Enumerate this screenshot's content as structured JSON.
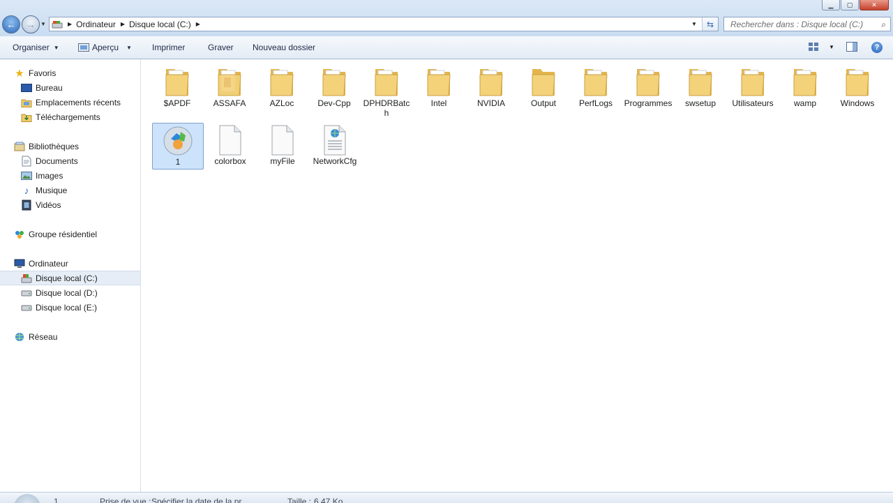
{
  "address": {
    "crumbs": [
      "Ordinateur",
      "Disque local (C:)"
    ]
  },
  "search": {
    "placeholder": "Rechercher dans : Disque local (C:)"
  },
  "toolbar": {
    "organize": "Organiser",
    "preview": "Aperçu",
    "print": "Imprimer",
    "burn": "Graver",
    "new_folder": "Nouveau dossier"
  },
  "sidebar": {
    "favorites": {
      "label": "Favoris",
      "items": [
        "Bureau",
        "Emplacements récents",
        "Téléchargements"
      ]
    },
    "libraries": {
      "label": "Bibliothèques",
      "items": [
        "Documents",
        "Images",
        "Musique",
        "Vidéos"
      ]
    },
    "homegroup": {
      "label": "Groupe résidentiel"
    },
    "computer": {
      "label": "Ordinateur",
      "items": [
        "Disque local (C:)",
        "Disque local (D:)",
        "Disque local (E:)"
      ]
    },
    "network": {
      "label": "Réseau"
    }
  },
  "content": {
    "folders": [
      "$APDF",
      "ASSAFA",
      "AZLoc",
      "Dev-Cpp",
      "DPHDRBatch",
      "Intel",
      "NVIDIA",
      "Output",
      "PerfLogs",
      "Programmes",
      "swsetup",
      "Utilisateurs",
      "wamp",
      "Windows"
    ],
    "files": [
      {
        "name": "1",
        "type": "app",
        "selected": true
      },
      {
        "name": "colorbox",
        "type": "blank",
        "selected": false
      },
      {
        "name": "myFile",
        "type": "blank",
        "selected": false
      },
      {
        "name": "NetworkCfg",
        "type": "config",
        "selected": false
      }
    ]
  },
  "details": {
    "name": "1",
    "date_label": "Prise de vue :",
    "date_value": "Spécifier la date de la pr...",
    "size_label": "Taille :",
    "size_value": "6,47 Ko"
  },
  "colors": {
    "accent": "#2c66b8",
    "selection": "#cce3fb",
    "folder": "#f3d27a"
  }
}
